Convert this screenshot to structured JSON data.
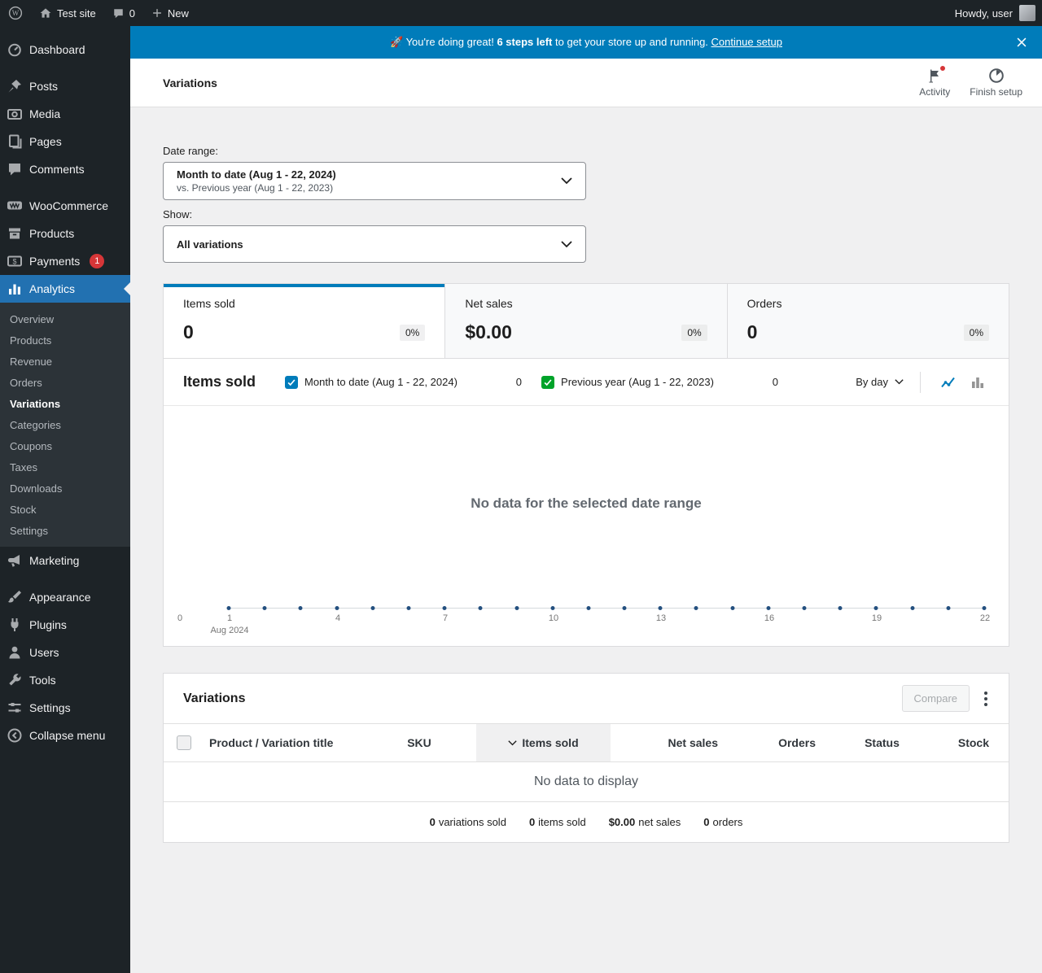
{
  "admin_bar": {
    "site_name": "Test site",
    "comments_count": "0",
    "new_label": "New",
    "howdy": "Howdy, user"
  },
  "banner": {
    "emoji": "🚀",
    "lead": "You're doing great!",
    "bold": "6 steps left",
    "rest": "to get your store up and running.",
    "link": "Continue setup"
  },
  "header": {
    "title": "Variations",
    "activity_label": "Activity",
    "finish_setup_label": "Finish setup"
  },
  "sidebar": {
    "items": [
      {
        "label": "Dashboard"
      },
      {
        "label": "Posts"
      },
      {
        "label": "Media"
      },
      {
        "label": "Pages"
      },
      {
        "label": "Comments"
      },
      {
        "label": "WooCommerce"
      },
      {
        "label": "Products"
      },
      {
        "label": "Payments",
        "badge": "1"
      },
      {
        "label": "Analytics"
      },
      {
        "label": "Marketing"
      },
      {
        "label": "Appearance"
      },
      {
        "label": "Plugins"
      },
      {
        "label": "Users"
      },
      {
        "label": "Tools"
      },
      {
        "label": "Settings"
      }
    ],
    "analytics_submenu": [
      {
        "label": "Overview"
      },
      {
        "label": "Products"
      },
      {
        "label": "Revenue"
      },
      {
        "label": "Orders"
      },
      {
        "label": "Variations",
        "current": true
      },
      {
        "label": "Categories"
      },
      {
        "label": "Coupons"
      },
      {
        "label": "Taxes"
      },
      {
        "label": "Downloads"
      },
      {
        "label": "Stock"
      },
      {
        "label": "Settings"
      }
    ],
    "collapse_label": "Collapse menu"
  },
  "filters": {
    "date_range_label": "Date range:",
    "date_range_value": "Month to date (Aug 1 - 22, 2024)",
    "date_range_compare": "vs. Previous year (Aug 1 - 22, 2023)",
    "show_label": "Show:",
    "show_value": "All variations"
  },
  "summary_tabs": [
    {
      "label": "Items sold",
      "value": "0",
      "delta": "0%",
      "selected": true
    },
    {
      "label": "Net sales",
      "value": "$0.00",
      "delta": "0%",
      "selected": false
    },
    {
      "label": "Orders",
      "value": "0",
      "delta": "0%",
      "selected": false
    }
  ],
  "chart": {
    "title": "Items sold",
    "legend": [
      {
        "label": "Month to date (Aug 1 - 22, 2024)",
        "value": "0",
        "color": "#007cba"
      },
      {
        "label": "Previous year (Aug 1 - 22, 2023)",
        "value": "0",
        "color": "#00a32a"
      }
    ],
    "interval_value": "By day",
    "empty_message": "No data for the selected date range",
    "x_ticks": [
      "0",
      "1",
      "4",
      "7",
      "10",
      "13",
      "16",
      "19",
      "22"
    ],
    "x_axis_sublabel": "Aug 2024"
  },
  "chart_data": {
    "type": "line",
    "title": "Items sold",
    "xlabel": "Aug 2024",
    "x": [
      1,
      2,
      3,
      4,
      5,
      6,
      7,
      8,
      9,
      10,
      11,
      12,
      13,
      14,
      15,
      16,
      17,
      18,
      19,
      20,
      21,
      22
    ],
    "series": [
      {
        "name": "Month to date (Aug 1 - 22, 2024)",
        "values": [
          0,
          0,
          0,
          0,
          0,
          0,
          0,
          0,
          0,
          0,
          0,
          0,
          0,
          0,
          0,
          0,
          0,
          0,
          0,
          0,
          0,
          0
        ]
      },
      {
        "name": "Previous year (Aug 1 - 22, 2023)",
        "values": [
          0,
          0,
          0,
          0,
          0,
          0,
          0,
          0,
          0,
          0,
          0,
          0,
          0,
          0,
          0,
          0,
          0,
          0,
          0,
          0,
          0,
          0
        ]
      }
    ],
    "y_ticks": [
      "0"
    ],
    "legend_position": "top",
    "grid": false
  },
  "table": {
    "title": "Variations",
    "compare_label": "Compare",
    "columns": [
      {
        "label": "Product / Variation title"
      },
      {
        "label": "SKU"
      },
      {
        "label": "Items sold",
        "sorted": true
      },
      {
        "label": "Net sales"
      },
      {
        "label": "Orders"
      },
      {
        "label": "Status"
      },
      {
        "label": "Stock"
      }
    ],
    "empty_message": "No data to display",
    "totals": [
      {
        "value": "0",
        "label": "variations sold"
      },
      {
        "value": "0",
        "label": "items sold"
      },
      {
        "value": "$0.00",
        "label": "net sales"
      },
      {
        "value": "0",
        "label": "orders"
      }
    ]
  },
  "colors": {
    "accent": "#007cba",
    "sidebar_active": "#2271b1",
    "notification": "#d63638",
    "series_primary": "#007cba",
    "series_secondary": "#00a32a"
  }
}
